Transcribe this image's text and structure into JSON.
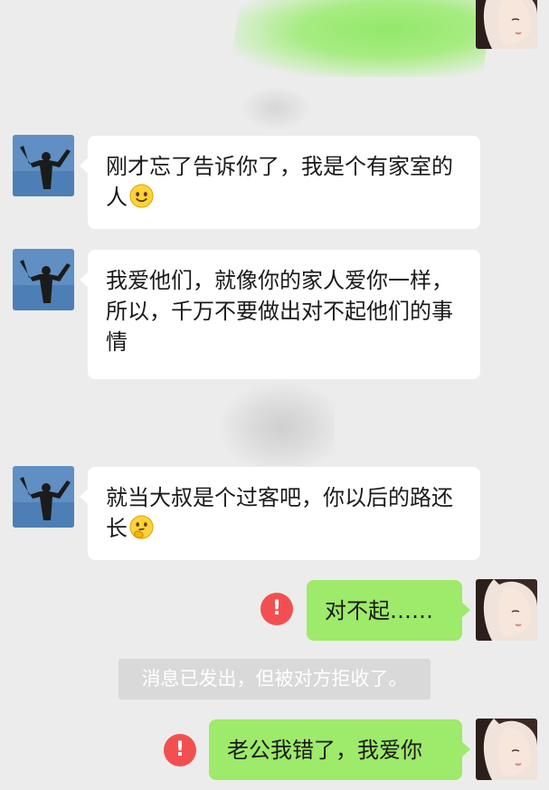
{
  "messages": [
    {
      "side": "left",
      "text": "刚才忘了告诉你了，我是个有家室的人",
      "emoji": "smile-emoji"
    },
    {
      "side": "left",
      "text": "我爱他们，就像你的家人爱你一样，所以，千万不要做出对不起他们的事情"
    },
    {
      "side": "left",
      "text": "就当大叔是个过客吧，你以后的路还长",
      "emoji": "thinking-emoji"
    },
    {
      "side": "right",
      "text": "对不起……",
      "status": "error"
    },
    {
      "side": "right",
      "text": "老公我错了，我爱你",
      "status": "error"
    }
  ],
  "system_notice": "消息已发出，但被对方拒收了。",
  "error_mark": "!",
  "colors": {
    "background": "#ececec",
    "bubble_left": "#ffffff",
    "bubble_right": "#9eea6a",
    "error": "#f25050"
  }
}
